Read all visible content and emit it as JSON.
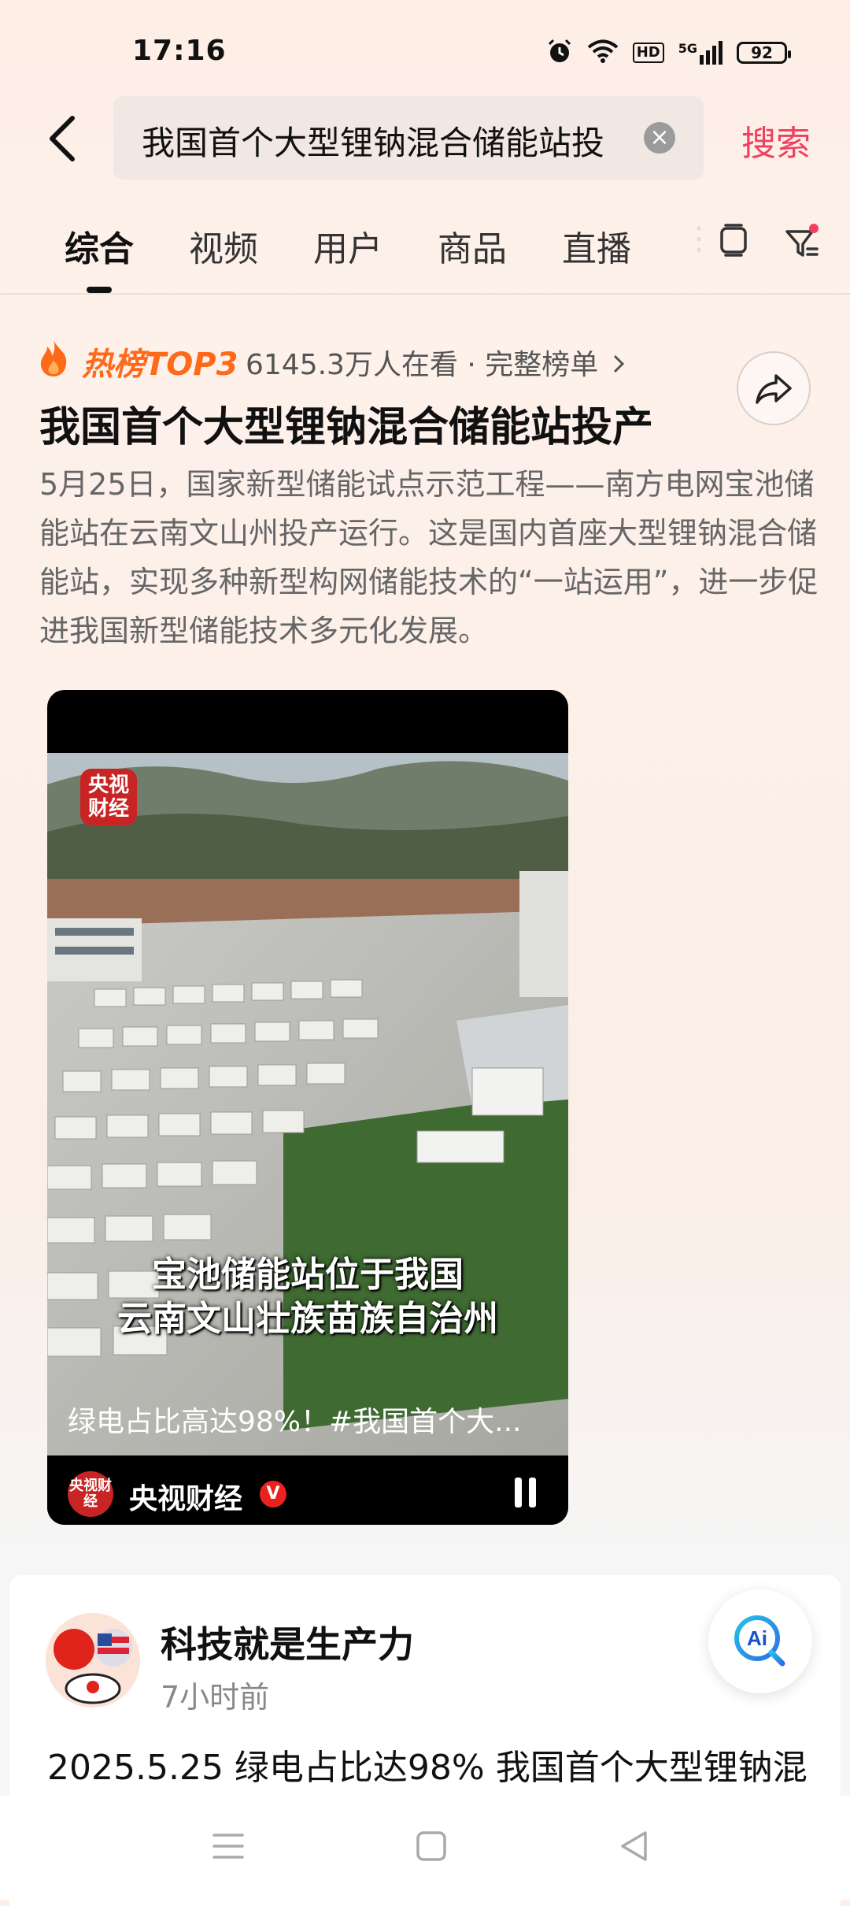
{
  "status_bar": {
    "time": "17:16",
    "hd": "HD",
    "signal_label": "5G",
    "battery": "92"
  },
  "search": {
    "query": "我国首个大型锂钠混合储能站投",
    "submit_label": "搜索"
  },
  "tabs": [
    {
      "label": "综合",
      "active": true
    },
    {
      "label": "视频"
    },
    {
      "label": "用户"
    },
    {
      "label": "商品"
    },
    {
      "label": "直播"
    }
  ],
  "hot_topic": {
    "badge": "热榜TOP3",
    "viewers": "6145.3万人在看 · 完整榜单",
    "headline": "我国首个大型锂钠混合储能站投产",
    "summary": "5月25日，国家新型储能试点示范工程——南方电网宝池储能站在云南文山州投产运行。这是国内首座大型锂钠混合储能站，实现多种新型构网储能技术的“一站运用”，进一步促进我国新型储能技术多元化发展。"
  },
  "video": {
    "logo_text": "央视财经",
    "subtitle_line1": "宝池储能站位于我国",
    "subtitle_line2": "云南文山壮族苗族自治州",
    "caption": "绿电占比高达98%！#我国首个大...",
    "channel_name": "央视财经",
    "verified_mark": "V"
  },
  "post": {
    "author": "科技就是生产力",
    "time": "7小时前",
    "text": "2025.5.25  绿电占比达98% 我国首个大型锂钠混"
  },
  "ai_button_label": "Ai",
  "colors": {
    "accent": "#f0405f",
    "hot": "#ff6a1a",
    "brand_red": "#c82423"
  }
}
